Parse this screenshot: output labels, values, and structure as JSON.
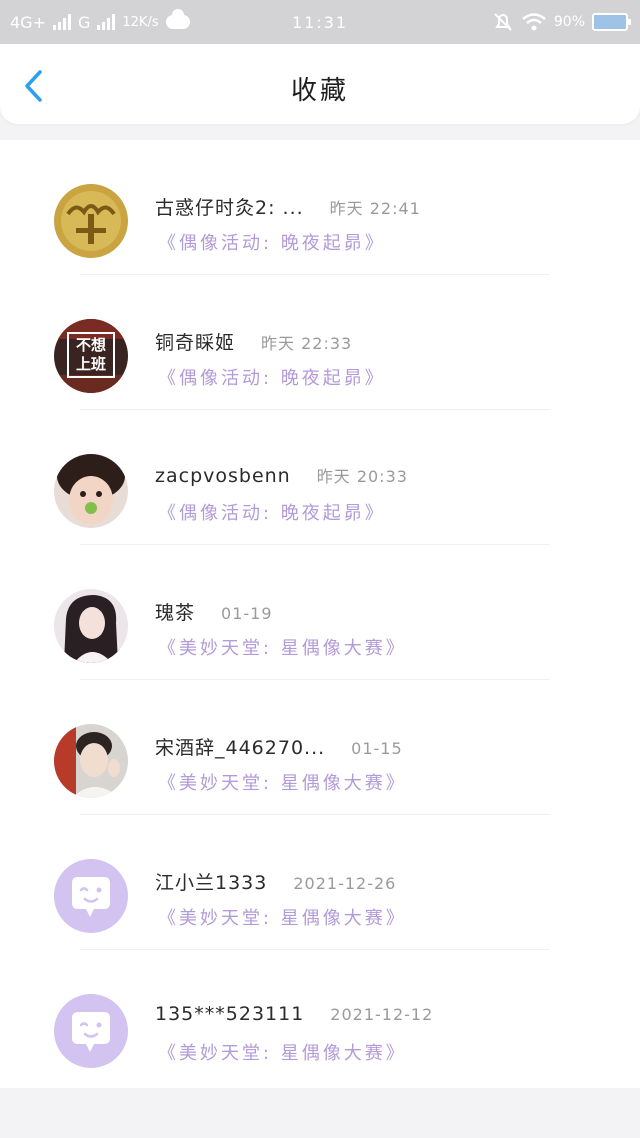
{
  "status_bar": {
    "network_left": "4G+",
    "network_mid": "G",
    "speed": "12K/s",
    "time": "11:31",
    "battery": "90%"
  },
  "header": {
    "title": "收藏",
    "back_icon": "chevron-left-icon"
  },
  "colors": {
    "accent_blue": "#2aa1f0",
    "activity_purple": "#b39ad8",
    "default_avatar": "#d3c3f0"
  },
  "items": [
    {
      "name": "古惑仔时灸2: ...",
      "time": "昨天 22:41",
      "activity": "《偶像活动: 晚夜起昴》",
      "avatar": "gold-coin-avatar"
    },
    {
      "name": "铜奇睬姬",
      "time": "昨天 22:33",
      "activity": "《偶像活动: 晚夜起昴》",
      "avatar": "text-avatar",
      "avatar_text": "不想上班"
    },
    {
      "name": "zacpvosbenn",
      "time": "昨天 20:33",
      "activity": "《偶像活动: 晚夜起昴》",
      "avatar": "child-photo-avatar"
    },
    {
      "name": "瑰茶",
      "time": "01-19",
      "activity": "《美妙天堂: 星偶像大赛》",
      "avatar": "girl-photo-avatar"
    },
    {
      "name": "宋酒辞_446270...",
      "time": "01-15",
      "activity": "《美妙天堂: 星偶像大赛》",
      "avatar": "boy-photo-avatar"
    },
    {
      "name": "江小兰1333",
      "time": "2021-12-26",
      "activity": "《美妙天堂: 星偶像大赛》",
      "avatar": "default-chat-avatar"
    },
    {
      "name": "135***523111",
      "time": "2021-12-12",
      "activity": "《美妙天堂: 星偶像大赛》",
      "avatar": "default-chat-avatar"
    }
  ]
}
